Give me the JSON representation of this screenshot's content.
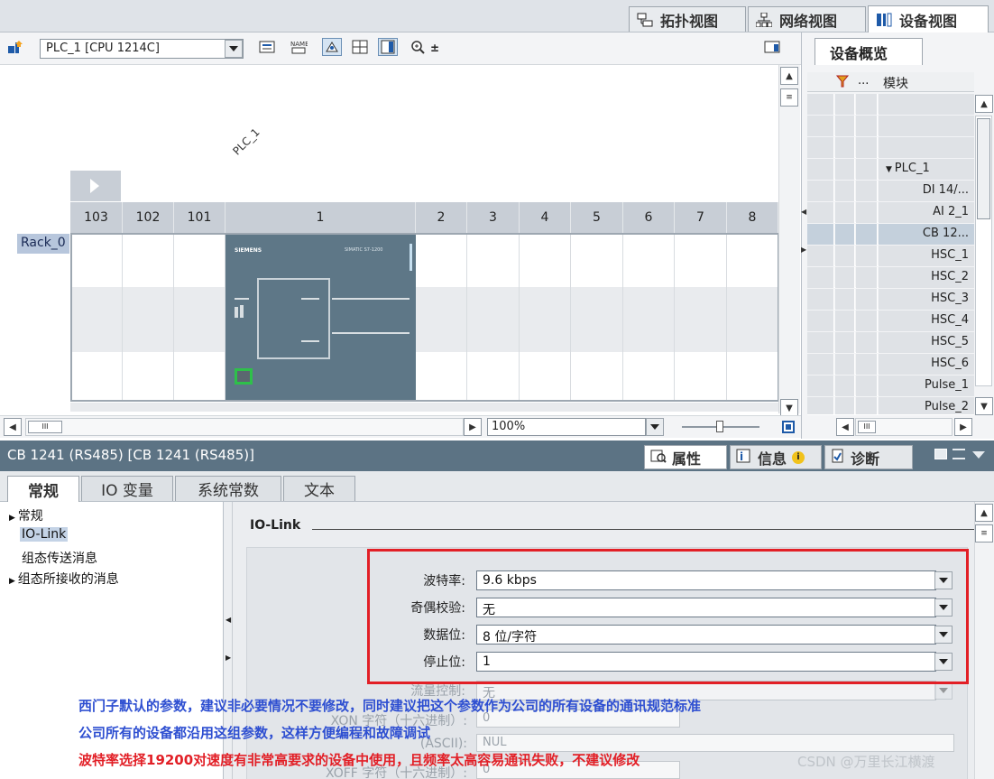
{
  "view_tabs": {
    "topology": "拓扑视图",
    "network": "网络视图",
    "device": "设备视图"
  },
  "toolbar": {
    "device_select": "PLC_1 [CPU 1214C]"
  },
  "canvas": {
    "plc_label": "PLC_1",
    "rack_name": "Rack_0",
    "slots": [
      "103",
      "102",
      "101",
      "1",
      "2",
      "3",
      "4",
      "5",
      "6",
      "7",
      "8"
    ],
    "cpu_brand": "SIEMENS",
    "cpu_model": "SIMATIC S7-1200",
    "zoom": "100%"
  },
  "overview": {
    "tab": "设备概览",
    "col_dots": "...",
    "col_module": "模块",
    "rows": [
      "",
      "",
      "",
      "PLC_1",
      "DI 14/...",
      "AI 2_1",
      "CB 12...",
      "HSC_1",
      "HSC_2",
      "HSC_3",
      "HSC_4",
      "HSC_5",
      "HSC_6",
      "Pulse_1",
      "Pulse_2"
    ]
  },
  "inspector": {
    "title": "CB 1241 (RS485) [CB 1241 (RS485)]",
    "tab_properties": "属性",
    "tab_info": "信息",
    "tab_diagnostics": "诊断",
    "sub_tabs": [
      "常规",
      "IO 变量",
      "系统常数",
      "文本"
    ],
    "nav": [
      "常规",
      "IO-Link",
      "组态传送消息",
      "组态所接收的消息"
    ],
    "section": "IO-Link",
    "fields": [
      {
        "label": "波特率:",
        "value": "9.6 kbps"
      },
      {
        "label": "奇偶校验:",
        "value": "无"
      },
      {
        "label": "数据位:",
        "value": "8 位/字符"
      },
      {
        "label": "停止位:",
        "value": "1"
      }
    ],
    "dim_fields": {
      "flow_label": "流量控制:",
      "flow_value": "无",
      "xon_label": "XON 字符（十六进制）:",
      "xon_value": "0",
      "ascii_label": "(ASCII):",
      "ascii_value": "NUL",
      "xoff_label": "XOFF 字符（十六进制）:",
      "xoff_value": "0"
    }
  },
  "annotations": {
    "line1": "西门子默认的参数，建议非必要情况不要修改，同时建议把这个参数作为公司的所有设备的通讯规范标准",
    "line2": "公司所有的设备都沿用这组参数，这样方便编程和故障调试",
    "line3": "波特率选择19200对速度有非常高要求的设备中使用，且频率太高容易通讯失败，不建议修改"
  },
  "watermark": "CSDN @万里长江横渡",
  "colors": {
    "accent_red": "#e21f26",
    "note_blue": "#2e4fd1",
    "title_bar": "#5c7384"
  }
}
